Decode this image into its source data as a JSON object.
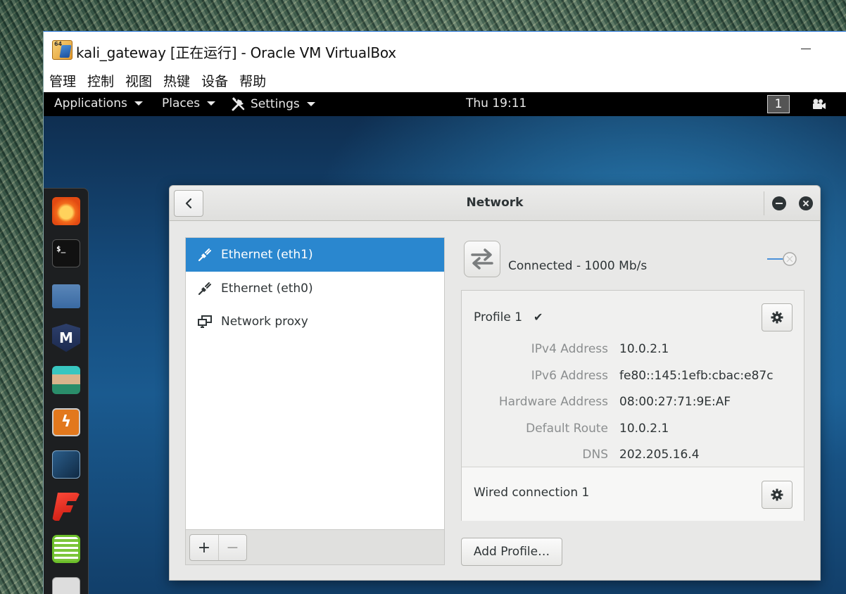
{
  "host_window": {
    "title": "kali_gateway [正在运行] - Oracle VM VirtualBox",
    "menu": [
      "管理",
      "控制",
      "视图",
      "热键",
      "设备",
      "帮助"
    ]
  },
  "topbar": {
    "applications": "Applications",
    "places": "Places",
    "settings": "Settings",
    "clock": "Thu 19:11",
    "workspace": "1"
  },
  "dock": {
    "apps": [
      "firefox-icon",
      "terminal-icon",
      "files-icon",
      "metasploit-icon",
      "armitage-icon",
      "burpsuite-icon",
      "maltego-icon",
      "faraday-icon",
      "leafpad-icon",
      "show-apps-icon"
    ]
  },
  "dialog": {
    "title": "Network",
    "devices": [
      {
        "label": "Ethernet (eth1)",
        "icon": "wired-plug-icon",
        "selected": true
      },
      {
        "label": "Ethernet (eth0)",
        "icon": "wired-plug-icon",
        "selected": false
      },
      {
        "label": "Network proxy",
        "icon": "network-proxy-icon",
        "selected": false
      }
    ],
    "add_label": "+",
    "remove_label": "−",
    "status": "Connected - 1000 Mb/s",
    "profile": {
      "name": "Profile 1",
      "check": "✔",
      "details": [
        {
          "label": "IPv4 Address",
          "value": "10.0.2.1"
        },
        {
          "label": "IPv6 Address",
          "value": "fe80::145:1efb:cbac:e87c"
        },
        {
          "label": "Hardware Address",
          "value": "08:00:27:71:9E:AF"
        },
        {
          "label": "Default Route",
          "value": "10.0.2.1"
        },
        {
          "label": "DNS",
          "value": "202.205.16.4"
        }
      ]
    },
    "wired_connection": "Wired connection 1",
    "add_profile": "Add Profile…"
  },
  "colors": {
    "selection": "#2a87cf",
    "topbar": "#000000",
    "dialog_bg": "#e8e8e7"
  }
}
